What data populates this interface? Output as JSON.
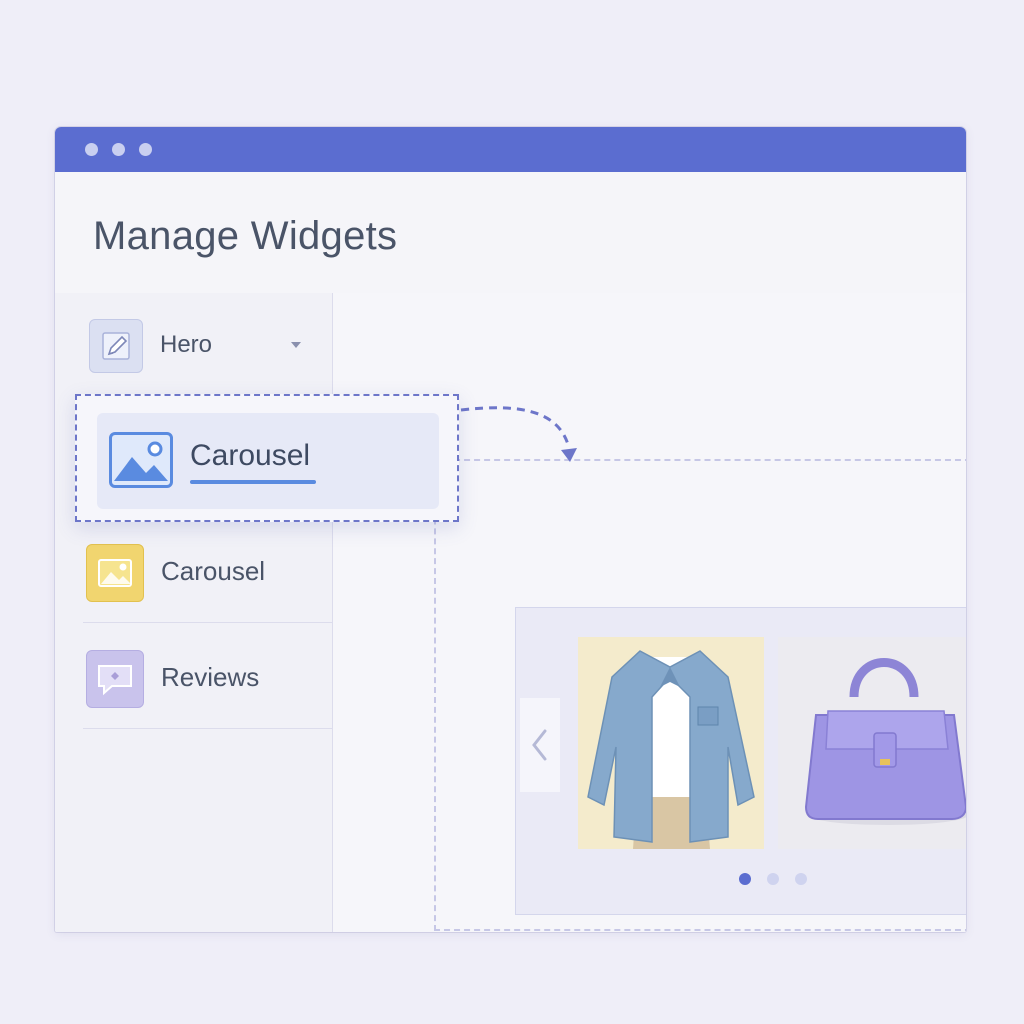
{
  "app": {
    "title": "Manage Widgets",
    "accent_color": "#5b6dd0",
    "window_controls": [
      "window-dot",
      "window-dot",
      "window-dot"
    ]
  },
  "sidebar": {
    "items": [
      {
        "label": "Hero",
        "icon": "pencil-icon",
        "has_dropdown": true
      },
      {
        "label": "Carousel",
        "icon": "image-icon"
      },
      {
        "label": "Reviews",
        "icon": "chat-bubble-icon"
      }
    ]
  },
  "drag": {
    "label": "Carousel",
    "icon": "image-icon",
    "state": "dragging"
  },
  "preview": {
    "slides": [
      {
        "icon": "denim-shirt-image"
      },
      {
        "icon": "purple-handbag-image"
      }
    ],
    "prev_icon": "chevron-left-icon",
    "next_icon": "chevron-right-icon",
    "pager": {
      "count": 3,
      "active": 1
    }
  }
}
